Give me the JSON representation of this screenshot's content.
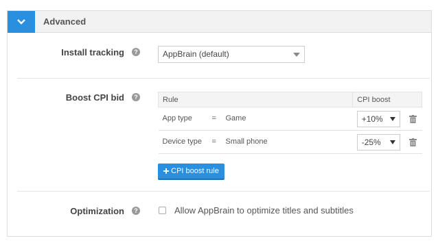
{
  "header": {
    "title": "Advanced",
    "toggle_icon": "chevron-down-icon",
    "accent": "#2b8fe0"
  },
  "install_tracking": {
    "label": "Install tracking",
    "selected": "AppBrain (default)"
  },
  "boost_cpi": {
    "label": "Boost CPI bid",
    "columns": [
      "Rule",
      "CPI boost"
    ],
    "rows": [
      {
        "attribute": "App type",
        "operator": "=",
        "value": "Game",
        "boost": "+10%"
      },
      {
        "attribute": "Device type",
        "operator": "=",
        "value": "Small phone",
        "boost": "-25%"
      }
    ],
    "add_button": "CPI boost rule"
  },
  "optimization": {
    "label": "Optimization",
    "checkbox_label": "Allow AppBrain to optimize titles and subtitles",
    "checked": false
  }
}
